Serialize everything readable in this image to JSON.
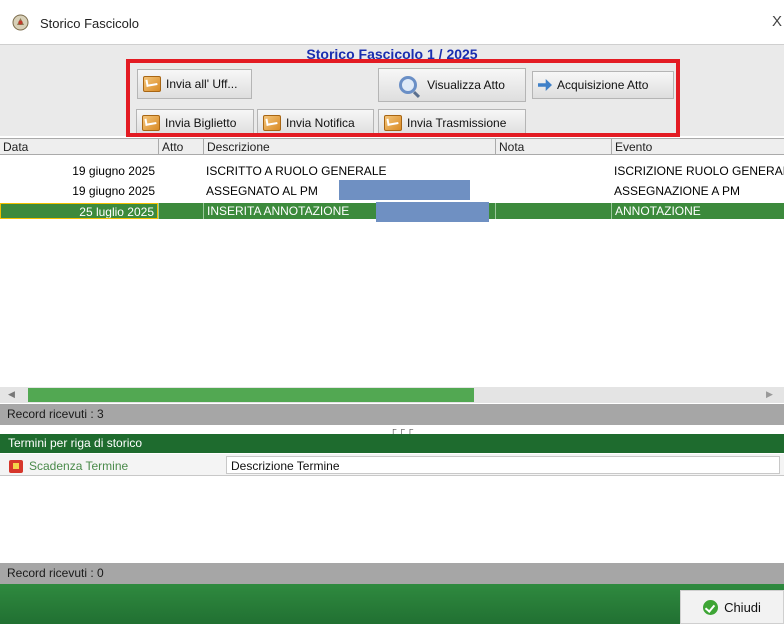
{
  "window": {
    "title": "Storico Fascicolo",
    "close_label": "X"
  },
  "heading": "Storico Fascicolo  1 / 2025",
  "toolbar": {
    "invia_uff": "Invia all' Uff...",
    "visualizza_atto": "Visualizza Atto",
    "acquisizione_atto": "Acquisizione Atto",
    "invia_biglietto": "Invia Biglietto",
    "invia_notifica": "Invia Notifica",
    "invia_trasmissione": "Invia Trasmissione"
  },
  "table": {
    "columns": [
      "Data",
      "Atto",
      "Descrizione",
      "Nota",
      "Evento"
    ],
    "rows": [
      {
        "data": "19 giugno 2025",
        "atto": "",
        "descrizione": "ISCRITTO A RUOLO GENERALE",
        "nota": "",
        "evento": "ISCRIZIONE RUOLO GENERALE",
        "selected": false
      },
      {
        "data": "19 giugno 2025",
        "atto": "",
        "descrizione": "ASSEGNATO AL PM",
        "nota": "",
        "evento": "ASSEGNAZIONE A PM",
        "selected": false
      },
      {
        "data": "25 luglio 2025",
        "atto": "",
        "descrizione": "INSERITA ANNOTAZIONE",
        "nota": "",
        "evento": "ANNOTAZIONE",
        "selected": true
      }
    ]
  },
  "status_top": "Record ricevuti : 3",
  "termini": {
    "title": "Termini per riga di storico",
    "col_scadenza": "Scadenza Termine",
    "col_descrizione": "Descrizione Termine"
  },
  "status_bottom": "Record ricevuti : 0",
  "close_button": "Chiudi",
  "colors": {
    "highlight": "#e31b23",
    "selected_row": "#3c8a3c",
    "section_header": "#1e6b2e",
    "heading": "#1a2fb0",
    "redaction": "#6f90c2"
  },
  "icons": {
    "title": "emblem-icon",
    "send": "envelope-icon",
    "view": "magnifier-icon",
    "acquire": "arrow-icon",
    "scadenza": "flag-icon",
    "close": "check-icon"
  }
}
